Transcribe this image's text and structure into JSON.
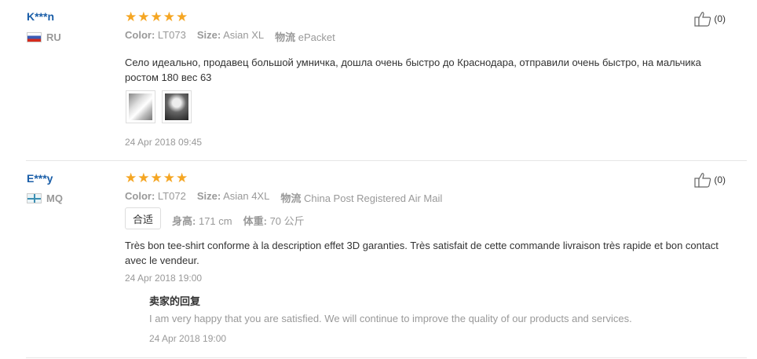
{
  "reviews": [
    {
      "user": "K***n",
      "country": "RU",
      "rating": 5,
      "color_label": "Color:",
      "color_value": "LT073",
      "size_label": "Size:",
      "size_value": "Asian XL",
      "logistics_label": "物流",
      "logistics_value": "ePacket",
      "text": "Село идеально, продавец большой умничка, дошла очень быстро до Краснодара, отправили очень быстро, на мальчика ростом 180 вес 63",
      "date": "24 Apr 2018 09:45",
      "likes": "(0)"
    },
    {
      "user": "E***y",
      "country": "MQ",
      "rating": 5,
      "color_label": "Color:",
      "color_value": "LT072",
      "size_label": "Size:",
      "size_value": "Asian 4XL",
      "logistics_label": "物流",
      "logistics_value": "China Post Registered Air Mail",
      "fit": "合适",
      "height_label": "身高:",
      "height_value": "171 cm",
      "weight_label": "体重:",
      "weight_value": "70 公斤",
      "text": "Très bon tee-shirt conforme à la description effet 3D garanties. Très satisfait de cette commande livraison très rapide et bon contact avec le vendeur.",
      "date": "24 Apr 2018 19:00",
      "likes": "(0)",
      "reply": {
        "title": "卖家的回复",
        "text": "I am very happy that you are satisfied. We will continue to improve the quality of our products and services.",
        "date": "24 Apr 2018 19:00"
      }
    }
  ],
  "icons": {
    "star": "star-icon",
    "like": "thumbs-up-icon"
  },
  "colors": {
    "star": "#f5a623",
    "username": "#1a5ea8",
    "muted": "#999999"
  }
}
